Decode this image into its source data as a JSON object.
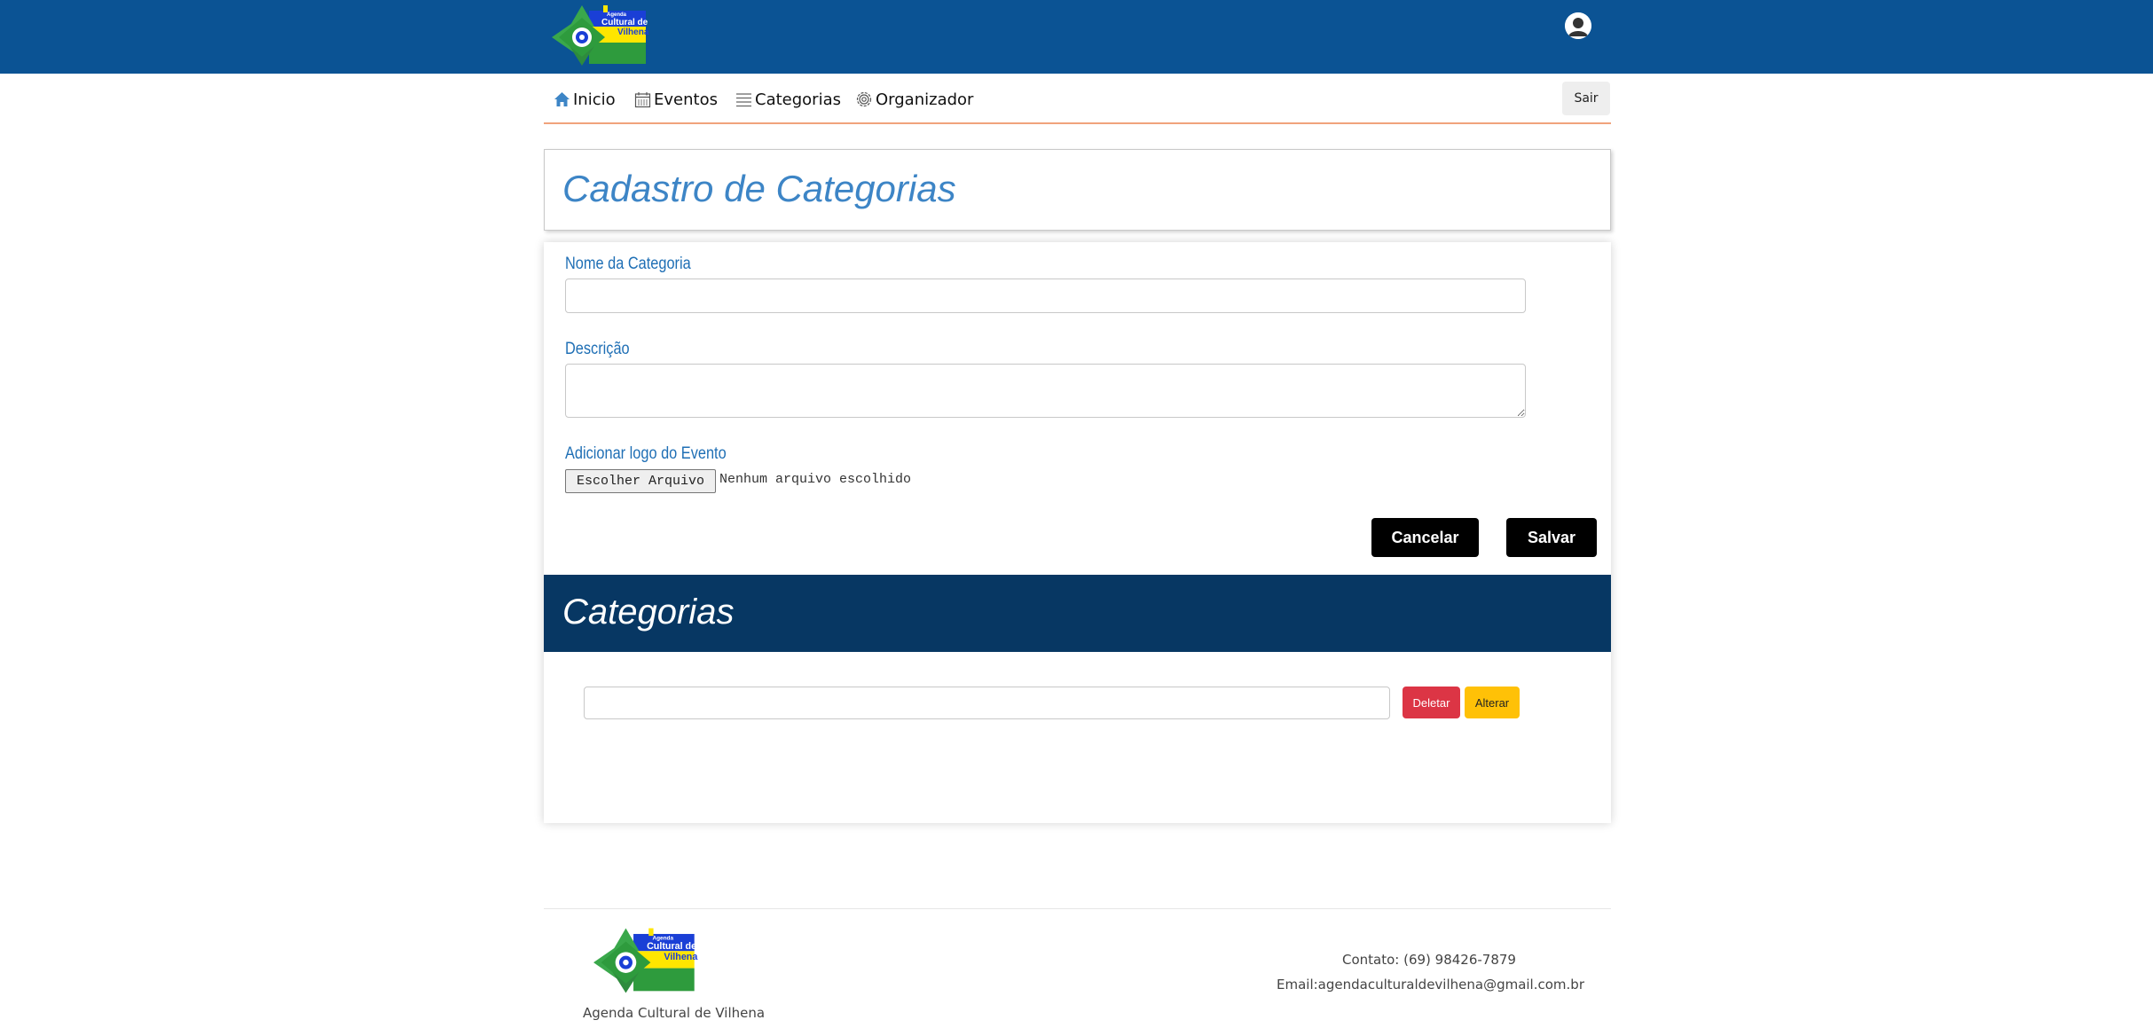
{
  "brand": {
    "name": "Agenda Cultural de Vilhena",
    "logo_text_line1": "Agenda",
    "logo_text_line2": "Cultural de",
    "logo_text_line3": "Vilhena"
  },
  "colors": {
    "header_blue": "#0b5394",
    "title_blue": "#3d85c6",
    "list_header_blue": "#073763",
    "delete_red": "#dc3545",
    "alter_yellow": "#ffc107"
  },
  "nav": {
    "items": [
      {
        "label": "Inicio",
        "icon": "home-icon"
      },
      {
        "label": "Eventos",
        "icon": "calendar-icon"
      },
      {
        "label": "Categorias",
        "icon": "list-icon"
      },
      {
        "label": "Organizador",
        "icon": "gear-icon"
      }
    ],
    "logout_label": "Sair"
  },
  "form": {
    "title": "Cadastro de Categorias",
    "name_label": "Nome da Categoria",
    "name_value": "",
    "description_label": "Descrição",
    "description_value": "",
    "logo_label": "Adicionar logo do Evento",
    "file_button_label": "Escolher Arquivo",
    "file_status": "Nenhum arquivo escolhido",
    "cancel_label": "Cancelar",
    "save_label": "Salvar"
  },
  "list": {
    "title": "Categorias",
    "rows": [
      {
        "value": "",
        "delete_label": "Deletar",
        "alter_label": "Alterar"
      }
    ]
  },
  "footer": {
    "brand_caption": "Agenda Cultural de Vilhena",
    "contact": "Contato: (69) 98426-7879",
    "email": "Email:agendaculturaldevilhena@gmail.com.br"
  }
}
